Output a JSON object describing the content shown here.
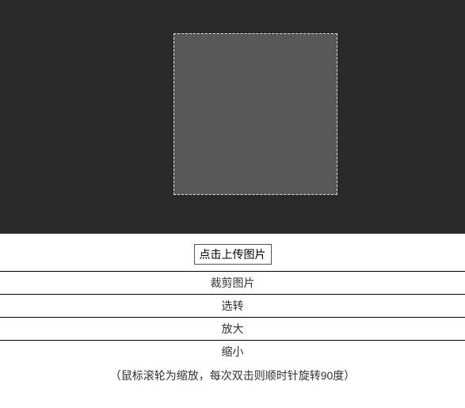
{
  "upload": {
    "label": "点击上传图片"
  },
  "actions": {
    "crop": "裁剪图片",
    "select_rotate": "选转",
    "zoom_in": "放大",
    "zoom_out": "缩小"
  },
  "hint": "（鼠标滚轮为缩放，每次双击则顺时针旋转90度）"
}
